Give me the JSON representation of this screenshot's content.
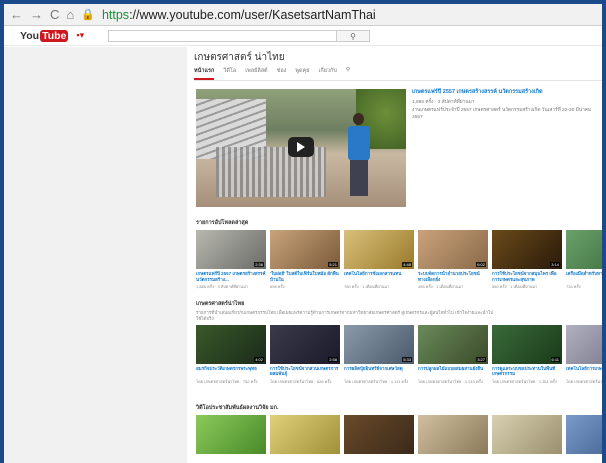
{
  "browser": {
    "url_scheme": "https",
    "url_rest": "://www.youtube.com/user/KasetsartNamThai"
  },
  "channel": {
    "title": "เกษตรศาสตร์ น่าไทย",
    "tabs": [
      "หน้าแรก",
      "วิดีโอ",
      "เพลย์ลิสต์",
      "ช่อง",
      "พูดคุย",
      "เกี่ยวกับ"
    ]
  },
  "featured": {
    "title": "เกษตรแฟร์ปี 2557 เกษตรสร้างสรรค์ นวัตกรรมสร้างเกิด",
    "meta": "1,885 ครั้ง · 3 สัปดาห์ที่ผ่านมา",
    "desc": "งานเกษตรแฟร์ประจำปี 2557 เกษตรศาสตร์ นวัตกรรมสร้างเกิด วันเสาร์ที่ 22-30 มีนาคม 2557"
  },
  "shelves": [
    {
      "title": "รายการอัปโหลดล่าสุด",
      "desc": "",
      "videos": [
        {
          "title": "เกษตรแฟร์ปี 2557 เกษตรสร้างสรรค์ นวัตกรรมสร้าง...",
          "meta": "1,885 ครั้ง · 3 สัปดาห์ที่ผ่านมา",
          "dur": "2:36",
          "c1": "#b8b8b0",
          "c2": "#6b6b68"
        },
        {
          "title": "'ใบฝอยี่' ใบสต์ใบเฟิร์นใบหม้อ ผักพื้นบ้านใน",
          "meta": "698 ครั้ง",
          "dur": "5:21",
          "c1": "#c8a37a",
          "c2": "#7b5a3a"
        },
        {
          "title": "เทคโนโลยีการชั่งเอกสารแทน",
          "meta": "780 ครั้ง · 1 เดือนที่ผ่านมา",
          "dur": "4:48",
          "c1": "#d8c07a",
          "c2": "#9a7a2a"
        },
        {
          "title": "ระบบจัดการน้ำอำนวยประโยชน์ ทางเลือกยั่ง",
          "meta": "455 ครั้ง · 1 เดือนที่ผ่านมา",
          "dur": "6:02",
          "c1": "#caa27a",
          "c2": "#8a6a4a"
        },
        {
          "title": "การใช้ประโยชน์จากสมุนไพร เพื่อการเกษตรและสุขภาพ",
          "meta": "560 ครั้ง · 1 เดือนที่ผ่านมา",
          "dur": "3:14",
          "c1": "#6a4a1a",
          "c2": "#2a1a0a"
        },
        {
          "title": "เครื่องมือสำหรับหาปูเนื้อ กรีน",
          "meta": "734 ครั้ง",
          "dur": "3:49",
          "c1": "#6aa06a",
          "c2": "#3a6a3a"
        }
      ]
    },
    {
      "title": "เกษตรศาสตร์น่าไทย",
      "desc": "รายการที่นำเสนอเกี่ยวกับเกษตรกรรมไทย เพื่อเผยแพร่ความรู้ด้านการเกษตรจากมหาวิทยาลัยเกษตรศาสตร์ สู่เกษตรกรและผู้สนใจทั่วไป เข้าใจง่ายและนำไปใช้ได้จริง",
      "videos": [
        {
          "title": "สมรกิจประวัติเกษตรกรพระพุทธ",
          "meta": "โดย เกษตรศาสตร์น่าไทย · 752 ครั้ง",
          "dur": "4:02",
          "c1": "#3a5a2a",
          "c2": "#1a2a1a"
        },
        {
          "title": "การใช้ประโยชน์จากสวนเกษตรการผสมพันธุ์",
          "meta": "โดย เกษตรศาสตร์น่าไทย · 826 ครั้ง",
          "dur": "2:58",
          "c1": "#3a3a4a",
          "c2": "#1a1a2a"
        },
        {
          "title": "การผลิตปุ๋ยอินทรีย์จากเศษวัสดุ",
          "meta": "โดย เกษตรศาสตร์น่าไทย · 1,111 ครั้ง",
          "dur": "5:33",
          "c1": "#8a9aaa",
          "c2": "#4a5a6a"
        },
        {
          "title": "การปลูกผลไม้แบบผสมผสานยั่งยืน",
          "meta": "โดย เกษตรศาสตร์น่าไทย · 1,210 ครั้ง",
          "dur": "3:27",
          "c1": "#6a8a5a",
          "c2": "#3a4a2a"
        },
        {
          "title": "การดูแลระบบชลประทานในพื้นที่เกษตรกรรม",
          "meta": "โดย เกษตรศาสตร์น่าไทย · 1,351 ครั้ง",
          "dur": "6:11",
          "c1": "#3a6a3a",
          "c2": "#1a3a1a"
        },
        {
          "title": "เทคโนโลยีการเกษตร",
          "meta": "โดย เกษตรศาสตร์น่าไทย · 1,075 ครั้ง",
          "dur": "4:45",
          "c1": "#b0b0c0",
          "c2": "#707080"
        }
      ]
    },
    {
      "title": "วิดีโอประชาสัมพันธ์ผลงานวิจัย มก.",
      "desc": "",
      "videos": [
        {
          "title": "",
          "meta": "",
          "dur": "",
          "c1": "#8aca5a",
          "c2": "#4a8a2a"
        },
        {
          "title": "",
          "meta": "",
          "dur": "",
          "c1": "#e0d07a",
          "c2": "#a0903a"
        },
        {
          "title": "",
          "meta": "",
          "dur": "",
          "c1": "#6a4a2a",
          "c2": "#3a2a1a"
        },
        {
          "title": "",
          "meta": "",
          "dur": "",
          "c1": "#d0c0a0",
          "c2": "#8a7a5a"
        },
        {
          "title": "",
          "meta": "",
          "dur": "",
          "c1": "#d8d0b0",
          "c2": "#9a9070"
        },
        {
          "title": "",
          "meta": "",
          "dur": "",
          "c1": "#7a9aca",
          "c2": "#3a5a8a"
        }
      ]
    }
  ]
}
